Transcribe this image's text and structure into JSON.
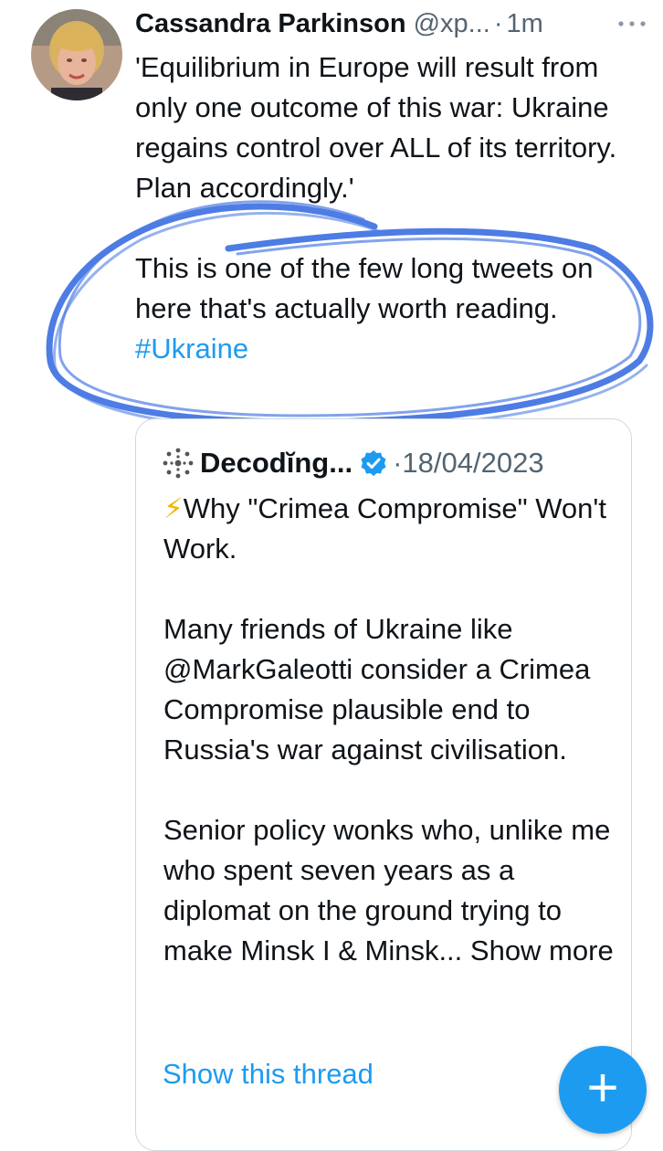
{
  "tweet": {
    "author_name": "Cassandra Parkinson",
    "handle": "@xp...",
    "separator": "·",
    "time": "1m",
    "paragraph1": "'Equilibrium in Europe will result from only one outcome of this war: Ukraine regains control over ALL of its territory. Plan accordingly.'",
    "paragraph2": "This is one of the few long tweets on here that's actually worth reading.",
    "hashtag": "#Ukraine"
  },
  "quoted": {
    "author_name": "Decodĭng...",
    "separator": "·",
    "date": "18/04/2023",
    "bolt": "⚡",
    "line1": "Why \"Crimea Compromise\" Won't Work.",
    "paragraph2": "Many friends of Ukraine like @MarkGaleotti consider a Crimea Compromise plausible end to Russia's war against civilisation.",
    "paragraph3": "Senior policy wonks who, unlike me who spent seven years as a diplomat on the ground trying to make Minsk I & Minsk... Show more"
  },
  "show_thread": "Show this thread",
  "fab_label": "+",
  "colors": {
    "link": "#1d9bf0",
    "secondary_text": "#536471",
    "annotation_ink": "#2f66e0"
  },
  "icons": [
    "more-options-icon",
    "verified-badge-icon",
    "compose-plus-icon",
    "account-logo-icon"
  ]
}
